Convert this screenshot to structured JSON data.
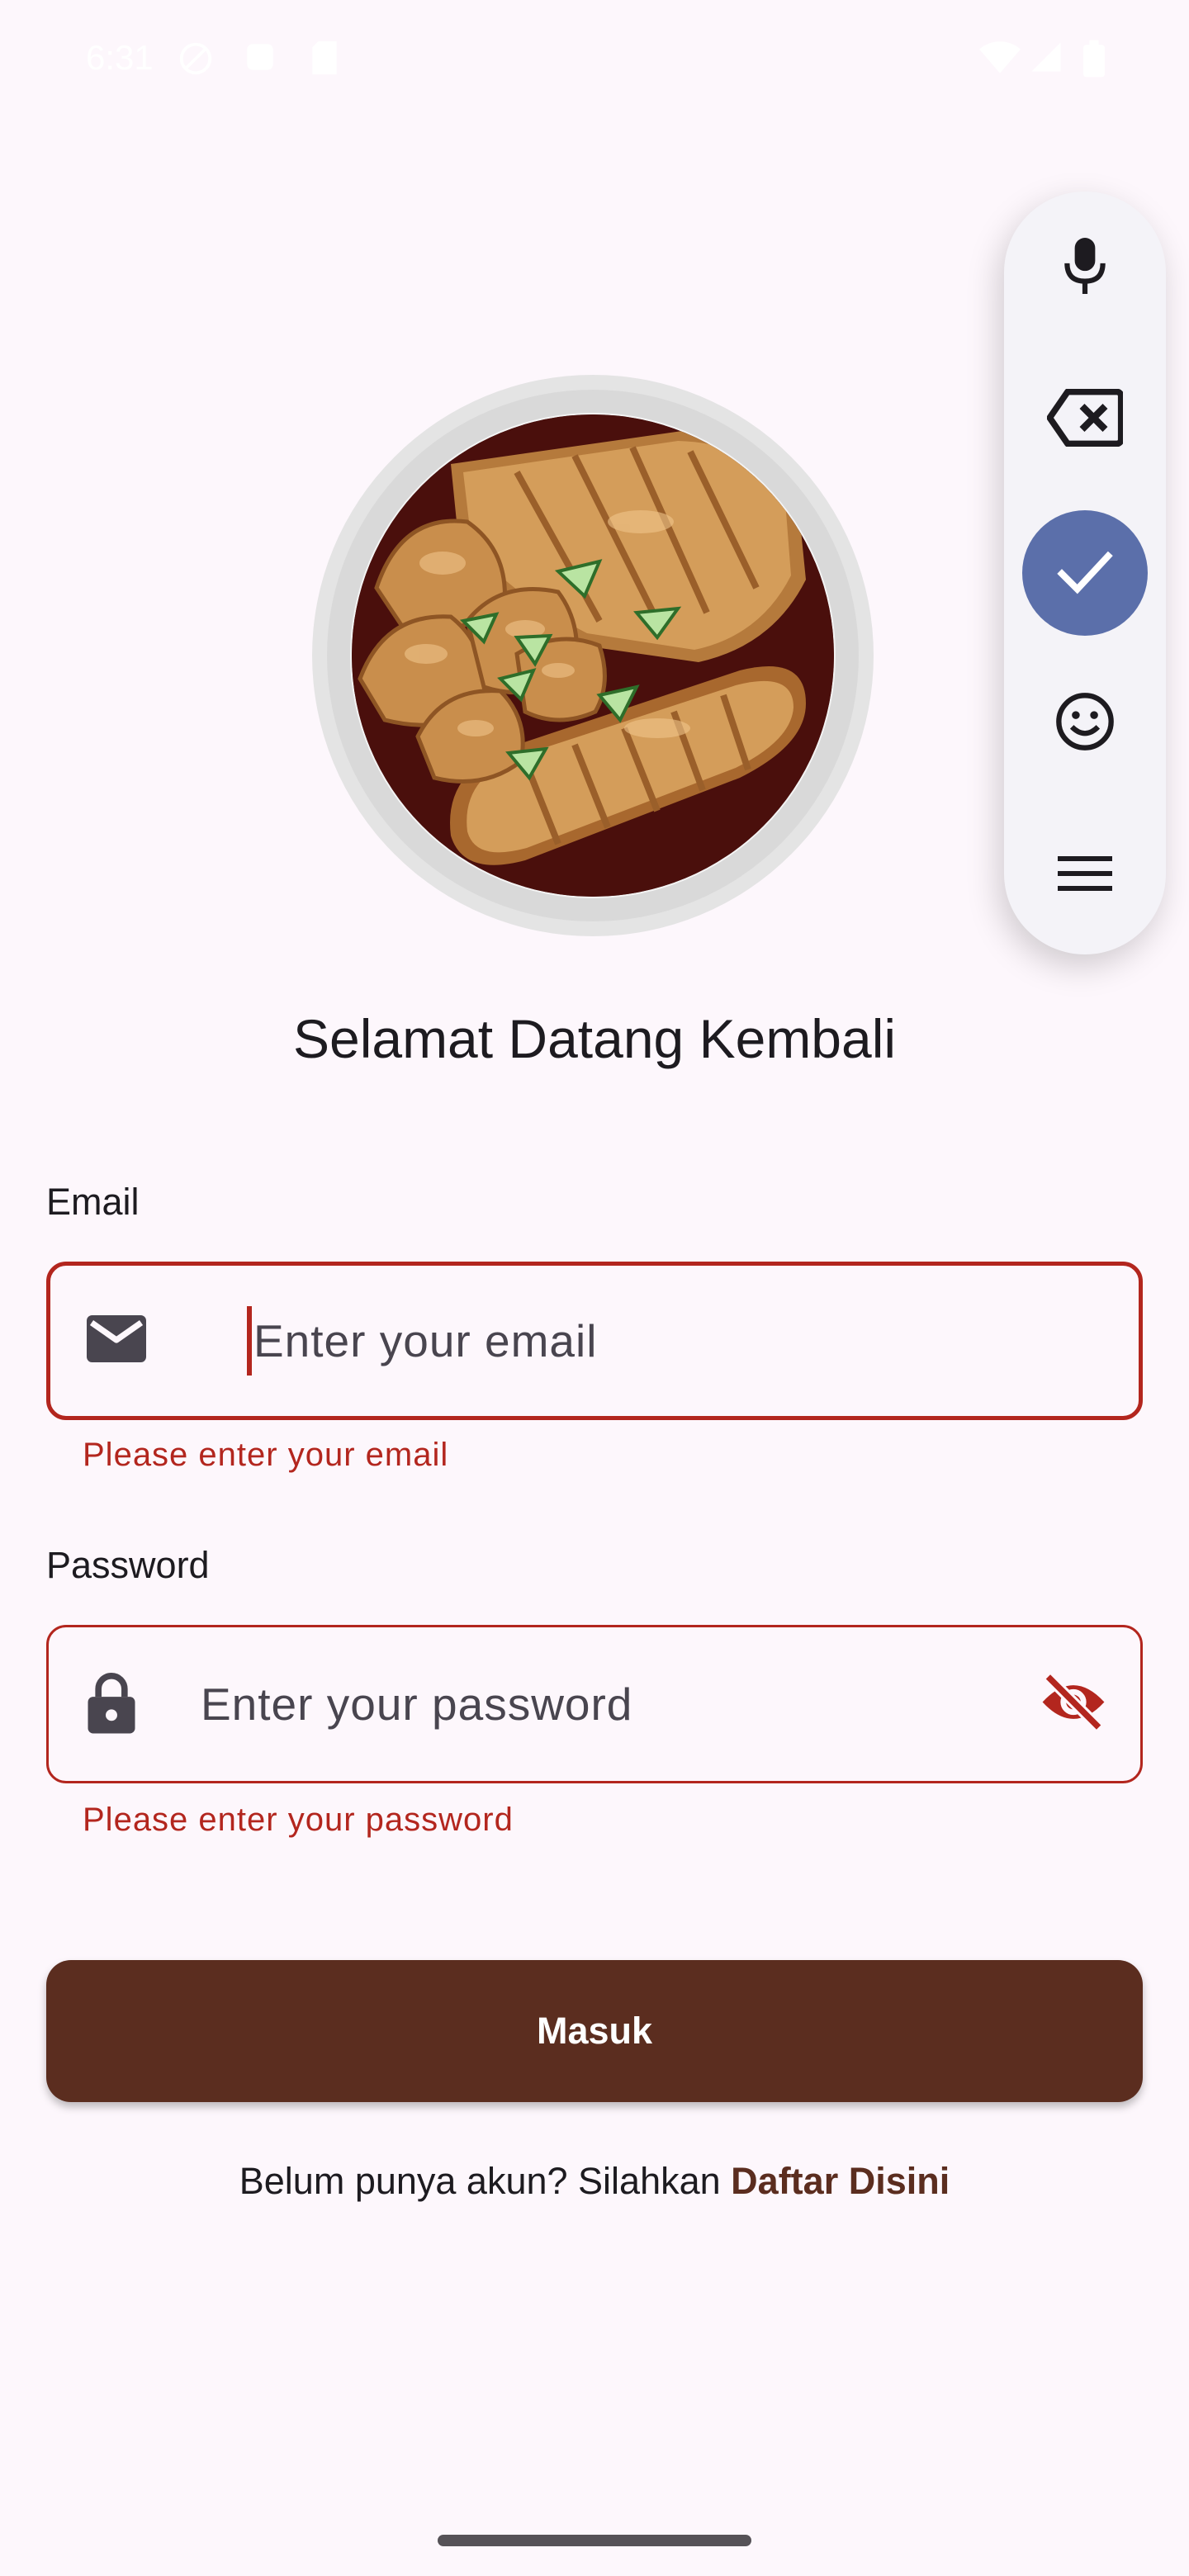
{
  "status_bar": {
    "time": "6:31",
    "icons": [
      "no-sync-icon",
      "alarm-icon",
      "sd-card-icon",
      "wifi-icon",
      "signal-icon",
      "battery-icon"
    ]
  },
  "hero": {
    "image": "food-plate-illustration"
  },
  "page_title": "Selamat Datang Kembali",
  "email": {
    "label": "Email",
    "placeholder": "Enter your email",
    "value": "",
    "error": "Please enter your email",
    "icon": "mail-icon"
  },
  "password": {
    "label": "Password",
    "placeholder": "Enter your password",
    "value": "",
    "error": "Please enter your password",
    "icon": "lock-icon",
    "toggle_icon": "visibility-off-icon"
  },
  "login_button": {
    "label": "Masuk"
  },
  "register_prompt": {
    "text": "Belum punya akun? Silahkan",
    "link": "Daftar Disini"
  },
  "floating_keyboard_toolbar": {
    "buttons": [
      "mic-icon",
      "backspace-icon",
      "check-icon",
      "emoji-icon",
      "menu-icon"
    ],
    "active": "check-icon"
  },
  "colors": {
    "background": "#fdf7fc",
    "error": "#b3261e",
    "brand": "#5b2d1f",
    "toolbar_accent": "#5b6faa"
  }
}
